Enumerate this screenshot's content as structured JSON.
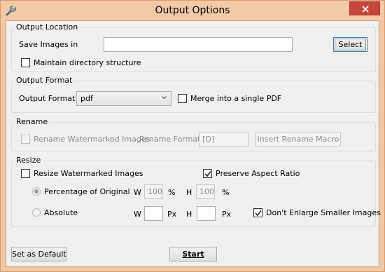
{
  "window": {
    "title": "Output Options",
    "icon": "wrench-icon",
    "close_icon": "close-icon",
    "accent_color": "#f2c7a4",
    "close_color": "#c7463a"
  },
  "output_location": {
    "group_title": "Output Location",
    "save_label": "Save Images in",
    "save_value": "",
    "select_button": "Select",
    "maintain_structure_label": "Maintain directory structure",
    "maintain_structure_checked": false
  },
  "output_format": {
    "group_title": "Output Format",
    "format_label": "Output Format",
    "format_value": "pdf",
    "merge_label": "Merge into a single PDF",
    "merge_checked": false
  },
  "rename": {
    "group_title": "Rename",
    "rename_label": "Rename Watermarked Images",
    "rename_checked": false,
    "format_label": "Rename Format",
    "format_value": "[O]",
    "insert_macro_button": "Insert Rename Macro"
  },
  "resize": {
    "group_title": "Resize",
    "resize_label": "Resize Watermarked Images",
    "resize_checked": false,
    "preserve_label": "Preserve Aspect Ratio",
    "preserve_checked": true,
    "percentage_label": "Percentage of Original",
    "percentage_selected": true,
    "w_label": "W",
    "h_label": "H",
    "percent_w": "100",
    "percent_h": "100",
    "percent_unit": "%",
    "absolute_label": "Absolute",
    "absolute_selected": false,
    "abs_w": "",
    "abs_h": "",
    "px_unit": "Px",
    "dont_enlarge_label": "Don't Enlarge Smaller Images",
    "dont_enlarge_checked": true
  },
  "footer": {
    "set_default_button": "Set as Default",
    "start_button": "Start"
  }
}
